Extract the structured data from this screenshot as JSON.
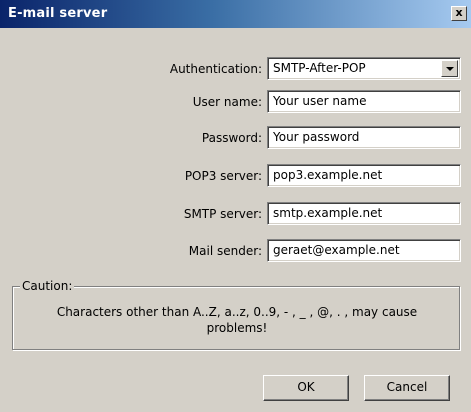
{
  "window": {
    "title": "E-mail server",
    "close_glyph": "x"
  },
  "form": {
    "authentication": {
      "label": "Authentication:",
      "value": "SMTP-After-POP"
    },
    "user_name": {
      "label": "User name:",
      "value": "Your user name"
    },
    "password": {
      "label": "Password:",
      "value": "Your password"
    },
    "pop3_server": {
      "label": "POP3 server:",
      "value": "pop3.example.net"
    },
    "smtp_server": {
      "label": "SMTP server:",
      "value": "smtp.example.net"
    },
    "mail_sender": {
      "label": "Mail sender:",
      "value": "geraet@example.net"
    }
  },
  "caution": {
    "legend": "Caution:",
    "line1": "Characters other than A..Z, a..z, 0..9, - , _ , @, . , may cause",
    "line2": "problems!"
  },
  "buttons": {
    "ok": "OK",
    "cancel": "Cancel"
  },
  "colors": {
    "title_gradient_start": "#0a246a",
    "title_gradient_end": "#a6caf0",
    "face": "#d4d0c8"
  }
}
